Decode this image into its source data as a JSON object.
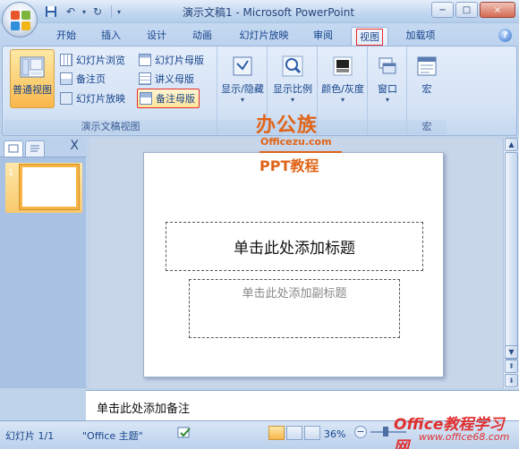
{
  "window": {
    "title": "演示文稿1 - Microsoft PowerPoint",
    "controls": [
      "−",
      "□",
      "×"
    ]
  },
  "qat": [
    "save-icon",
    "undo-icon",
    "redo-icon"
  ],
  "tabs": [
    {
      "label": "开始"
    },
    {
      "label": "插入"
    },
    {
      "label": "设计"
    },
    {
      "label": "动画"
    },
    {
      "label": "幻灯片放映"
    },
    {
      "label": "审阅"
    },
    {
      "label": "视图",
      "active": true
    },
    {
      "label": "加载项"
    }
  ],
  "ribbon": {
    "presentation_views": {
      "label": "演示文稿视图",
      "normal": "普通视图",
      "slide_sorter": "幻灯片浏览",
      "notes_page": "备注页",
      "slide_show": "幻灯片放映",
      "slide_master": "幻灯片母版",
      "handout_master": "讲义母版",
      "notes_master": "备注母版"
    },
    "show_hide": "显示/隐藏",
    "zoom": "显示比例",
    "color_gray": "颜色/灰度",
    "window": "窗口",
    "macros": {
      "button": "宏",
      "label": "宏"
    }
  },
  "slides_pane": {
    "close": "X",
    "thumb_number": "1"
  },
  "slide": {
    "title_placeholder": "单击此处添加标题",
    "subtitle_placeholder": "单击此处添加副标题"
  },
  "notes": {
    "placeholder": "单击此处添加备注"
  },
  "status": {
    "slide_info": "幻灯片 1/1",
    "theme": "\"Office 主题\"",
    "zoom": "36%"
  },
  "watermark": {
    "logo": "办公族",
    "url": "Officezu.com",
    "tag": "PPT教程",
    "bottom_logo": "Office教程学习网",
    "bottom_url": "www.office68.com"
  },
  "colors": {
    "accent": "#15428b",
    "selected": "#f9b54a",
    "highlight_box": "#e32b2b",
    "watermark": "#e06418"
  }
}
